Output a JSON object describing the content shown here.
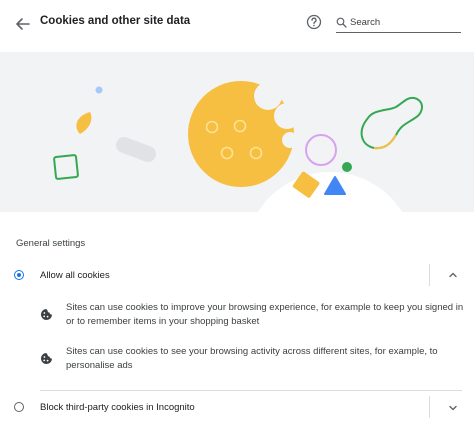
{
  "header": {
    "title": "Cookies and other site data",
    "search_placeholder": "Search"
  },
  "icons": {
    "back": "arrow-back-icon",
    "help": "help-icon",
    "search": "search-icon",
    "cookie": "cookie-icon",
    "chevron_up": "chevron-up-icon",
    "chevron_down": "chevron-down-icon"
  },
  "colors": {
    "accent": "#1a73e8",
    "cookie_yellow": "#f6bf41",
    "green": "#34a853",
    "blue": "#4285f4",
    "purple": "#d9a2f1",
    "hero_background": "#f1f3f4"
  },
  "general_settings": {
    "heading": "General settings",
    "options": [
      {
        "label": "Allow all cookies",
        "selected": true,
        "expanded": true,
        "details": [
          "Sites can use cookies to improve your browsing experience, for example to keep you signed in or to remember items in your shopping basket",
          "Sites can use cookies to see your browsing activity across different sites, for example, to personalise ads"
        ]
      },
      {
        "label": "Block third-party cookies in Incognito",
        "selected": false,
        "expanded": false
      }
    ]
  }
}
